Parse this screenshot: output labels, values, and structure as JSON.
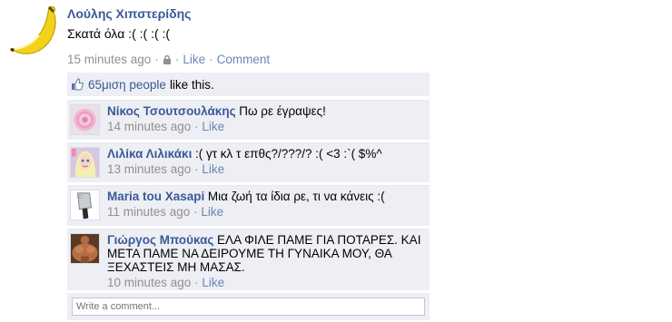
{
  "post": {
    "author": "Λούλης Χιπστερίδης",
    "message": "Σκατά όλα :( :( :( :(",
    "timestamp": "15 minutes ago",
    "sep": "·",
    "like_label": "Like",
    "comment_label": "Comment"
  },
  "likes": {
    "count_link": "65μιση people",
    "tail": "like this."
  },
  "comments": [
    {
      "name": "Νίκος Τσουτσουλάκης",
      "text": "Πω ρε έγραψες!",
      "time": "14 minutes ago",
      "like": "Like"
    },
    {
      "name": "Λιλίκα Λιλικάκι",
      "text": ":( γτ κλ τ επθς?/???/? :( <3 :`( $%^",
      "time": "13 minutes ago",
      "like": "Like"
    },
    {
      "name": "Maria tou Xasapi",
      "text": "Μια ζωή τα ίδια ρε, τι να κάνεις :(",
      "time": "11 minutes ago",
      "like": "Like"
    },
    {
      "name": "Γιώργος Μπούκας",
      "text": "ΕΛΑ ΦΙΛΕ ΠΑΜΕ ΓΙΑ ΠΟΤΑΡΕΣ. ΚΑΙ ΜΕΤΑ ΠΑΜΕ ΝΑ ΔΕΙΡΟΥΜΕ ΤΗ ΓΥΝΑΙΚΑ ΜΟΥ, ΘΑ ΞΕΧΑΣΤΕΙΣ ΜΗ ΜΑΣΑΣ.",
      "time": "10 minutes ago",
      "like": "Like"
    }
  ],
  "composer": {
    "placeholder": "Write a comment..."
  },
  "colors": {
    "link": "#3b5998",
    "panel": "#edeff4",
    "meta": "#909090"
  }
}
